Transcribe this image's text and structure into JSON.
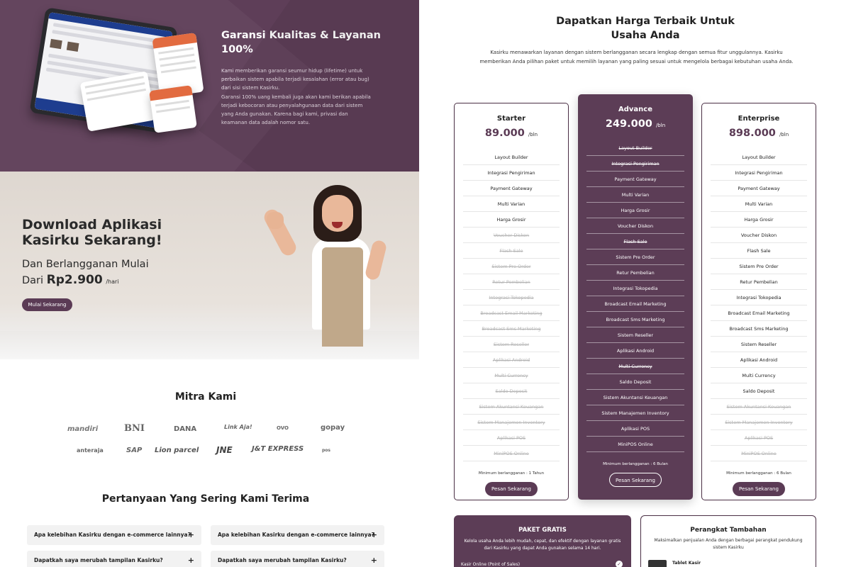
{
  "hero": {
    "title": "Garansi Kualitas & Layanan 100%",
    "p1": "Kami memberikan garansi seumur hidup (lifetime) untuk perbaikan sistem apabila terjadi kesalahan (error atau bug) dari sisi sistem Kasirku.",
    "p2": "Garansi 100% uang kembali juga akan kami berikan apabila terjadi kebocoran atau penyalahgunaan data dari sistem yang Anda gunakan. Karena bagi kami, privasi dan keamanan data adalah nomor satu."
  },
  "download": {
    "title": "Download Aplikasi Kasirku Sekarang!",
    "sub1": "Dan Berlangganan Mulai",
    "sub2": "Dari",
    "price": "Rp2.900",
    "unit": "/hari",
    "button": "Mulai Sekarang"
  },
  "mitra": {
    "title": "Mitra Kami",
    "logos": [
      "mandiri",
      "BNI",
      "DANA",
      "Link Aja!",
      "OVO",
      "gopay",
      "anteraja",
      "SAP",
      "Lion parcel",
      "JNE",
      "J&T EXPRESS",
      "pos"
    ]
  },
  "faq": {
    "title": "Pertanyaan Yang Sering Kami Terima",
    "q1": "Apa kelebihan Kasirku dengan e-commerce lainnya?",
    "q2": "Dapatkah saya merubah tampilan Kasirku?",
    "plus": "+"
  },
  "pricing": {
    "title": "Dapatkan Harga Terbaik Untuk Usaha Anda",
    "desc": "Kasirku menawarkan layanan dengan sistem berlangganan secara lengkap dengan semua fitur unggulannya. Kasirku memberikan Anda pilihan paket untuk memilih layanan yang paling sesuai untuk mengelola berbagai kebutuhan usaha Anda.",
    "unit": "/bln",
    "button": "Pesan Sekarang",
    "features": [
      "Layout Builder",
      "Integrasi Pengiriman",
      "Payment Gateway",
      "Multi Varian",
      "Harga Grosir",
      "Voucher Diskon",
      "Flash Sale",
      "Sistem Pre Order",
      "Retur Pembelian",
      "Integrasi Tokopedia",
      "Broadcast Email Marketing",
      "Broadcast Sms Marketing",
      "Sistem Reseller",
      "Aplikasi Android",
      "Multi Currency",
      "Saldo Deposit",
      "Sistem Akuntansi Keuangan",
      "Sistem Manajemen Inventory",
      "Aplikasi POS",
      "MiniPOS Online"
    ],
    "plans": [
      {
        "name": "Starter",
        "price": "89.000",
        "min": "Minimum berlangganan : 1 Tahun",
        "enabled": [
          0,
          1,
          2,
          3,
          4
        ]
      },
      {
        "name": "Advance",
        "price": "249.000",
        "min": "Minimum berlangganan : 6 Bulan",
        "enabled": [
          2,
          3,
          4,
          5,
          7,
          8,
          9,
          10,
          11,
          12,
          13,
          15,
          16,
          17,
          18,
          19
        ]
      },
      {
        "name": "Enterprise",
        "price": "898.000",
        "min": "Minimum berlangganan : 6 Bulan",
        "enabled": [
          0,
          1,
          2,
          3,
          4,
          5,
          6,
          7,
          8,
          9,
          10,
          11,
          12,
          13,
          14,
          15
        ]
      }
    ]
  },
  "gratis": {
    "title": "PAKET GRATIS",
    "desc": "Kelola usaha Anda lebih mudah, cepat, dan efektif dengan layanan gratis dari Kasirku yang dapat Anda gunakan selama 14 hari.",
    "item": "Kasir Online (Point of Sales)"
  },
  "perangkat": {
    "title": "Perangkat Tambahan",
    "desc": "Maksimalkan penjualan Anda dengan berbagai perangkat pendukung sistem Kasirku",
    "item": "Tablet Kasir"
  },
  "colors": {
    "brand": "#5c3d56",
    "disabled": "#b5b5b5"
  }
}
